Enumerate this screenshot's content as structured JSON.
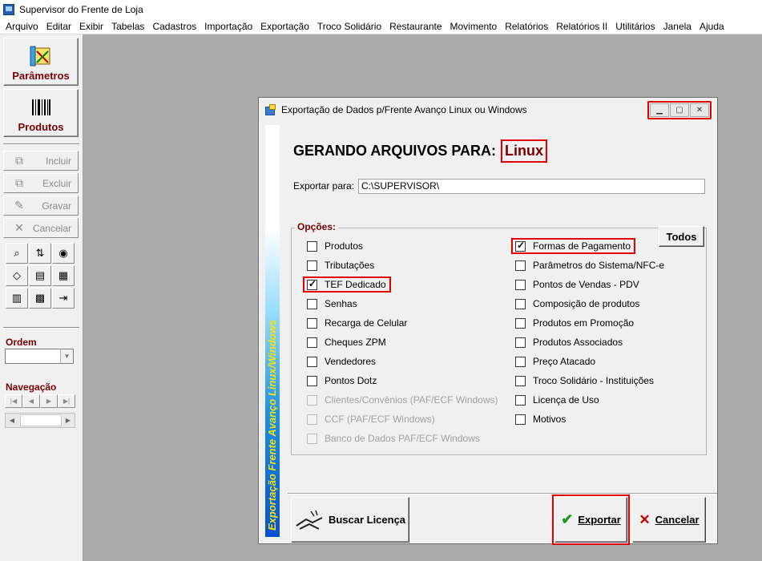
{
  "app": {
    "title": "Supervisor do Frente de Loja"
  },
  "menu": [
    "Arquivo",
    "Editar",
    "Exibir",
    "Tabelas",
    "Cadastros",
    "Importação",
    "Exportação",
    "Troco Solidário",
    "Restaurante",
    "Movimento",
    "Relatórios",
    "Relatórios II",
    "Utilitários",
    "Janela",
    "Ajuda"
  ],
  "sidebar": {
    "parametros": "Parâmetros",
    "produtos": "Produtos",
    "incluir": "Incluir",
    "excluir": "Excluir",
    "gravar": "Gravar",
    "cancelar": "Cancelar",
    "ordem": "Ordem",
    "navegacao": "Navegação"
  },
  "dialog": {
    "title": "Exportação de Dados p/Frente Avanço Linux ou Windows",
    "banner": "Exportação Frente Avanço Linux/Windows",
    "heading": "GERANDO ARQUIVOS PARA:",
    "target": "Linux",
    "export_label": "Exportar para:",
    "export_path": "C:\\SUPERVISOR\\",
    "options_title": "Opções:",
    "todos": "Todos",
    "left_options": [
      {
        "label": "Produtos",
        "checked": false,
        "disabled": false
      },
      {
        "label": "Tributações",
        "checked": false,
        "disabled": false
      },
      {
        "label": "TEF Dedicado",
        "checked": true,
        "disabled": false
      },
      {
        "label": "Senhas",
        "checked": false,
        "disabled": false
      },
      {
        "label": "Recarga de Celular",
        "checked": false,
        "disabled": false
      },
      {
        "label": "Cheques ZPM",
        "checked": false,
        "disabled": false
      },
      {
        "label": "Vendedores",
        "checked": false,
        "disabled": false
      },
      {
        "label": "Pontos Dotz",
        "checked": false,
        "disabled": false
      },
      {
        "label": "Clientes/Convênios (PAF/ECF Windows)",
        "checked": false,
        "disabled": true
      },
      {
        "label": "CCF (PAF/ECF Windows)",
        "checked": false,
        "disabled": true
      },
      {
        "label": "Banco de Dados PAF/ECF Windows",
        "checked": false,
        "disabled": true
      }
    ],
    "right_options": [
      {
        "label": "Formas de Pagamento",
        "checked": true,
        "disabled": false
      },
      {
        "label": "Parâmetros do Sistema/NFC-e",
        "checked": false,
        "disabled": false
      },
      {
        "label": "Pontos de Vendas - PDV",
        "checked": false,
        "disabled": false
      },
      {
        "label": "Composição de produtos",
        "checked": false,
        "disabled": false
      },
      {
        "label": "Produtos em Promoção",
        "checked": false,
        "disabled": false
      },
      {
        "label": "Produtos Associados",
        "checked": false,
        "disabled": false
      },
      {
        "label": "Preço Atacado",
        "checked": false,
        "disabled": false
      },
      {
        "label": "Troco Solidário - Instituições",
        "checked": false,
        "disabled": false
      },
      {
        "label": "Licença de Uso",
        "checked": false,
        "disabled": false
      },
      {
        "label": "Motivos",
        "checked": false,
        "disabled": false
      }
    ],
    "buscar": "Buscar Licença",
    "exportar": "Exportar",
    "cancelar": "Cancelar"
  }
}
